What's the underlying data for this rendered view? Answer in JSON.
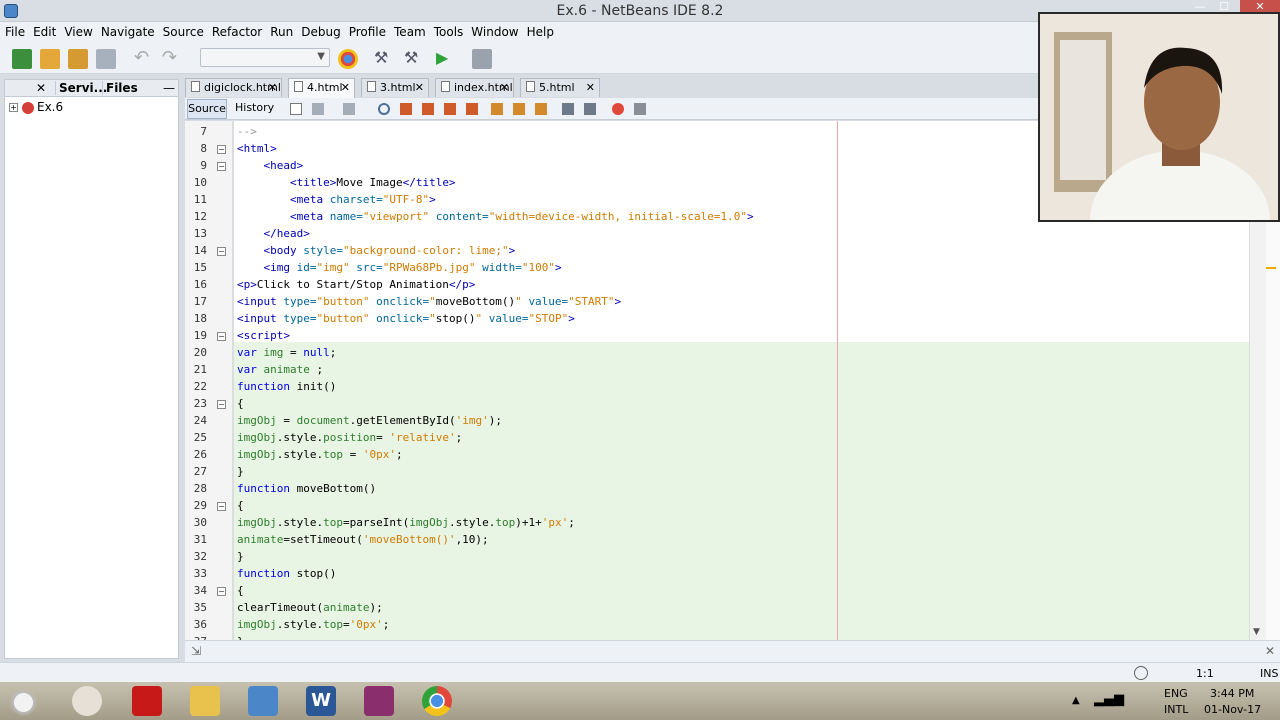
{
  "window": {
    "title": "Ex.6 - NetBeans IDE 8.2",
    "minimize": "—",
    "maximize": "☐",
    "close": "✕"
  },
  "menu": [
    "File",
    "Edit",
    "View",
    "Navigate",
    "Source",
    "Refactor",
    "Run",
    "Debug",
    "Profile",
    "Team",
    "Tools",
    "Window",
    "Help"
  ],
  "left_panel": {
    "tabs": [
      "Servi...",
      "Files"
    ],
    "close_symbol": "✕",
    "minimize_symbol": "—",
    "project": {
      "expander": "+",
      "name": "Ex.6"
    }
  },
  "editor_tabs": [
    {
      "label": "digiclock.html",
      "active": false
    },
    {
      "label": "4.html",
      "active": true
    },
    {
      "label": "3.html",
      "active": false
    },
    {
      "label": "index.html",
      "active": false
    },
    {
      "label": "5.html",
      "active": false
    }
  ],
  "editor_toolbar": {
    "source": "Source",
    "history": "History"
  },
  "code": {
    "lines": [
      {
        "n": "7",
        "fold": "",
        "segs": [
          [
            "cmt",
            "-->"
          ]
        ]
      },
      {
        "n": "8",
        "fold": "−",
        "segs": [
          [
            "tag",
            "<html>"
          ]
        ]
      },
      {
        "n": "9",
        "fold": "−",
        "segs": [
          [
            "",
            "    "
          ],
          [
            "tag",
            "<head>"
          ]
        ]
      },
      {
        "n": "10",
        "fold": "",
        "segs": [
          [
            "",
            "        "
          ],
          [
            "tag",
            "<title>"
          ],
          [
            "",
            "Move Image"
          ],
          [
            "tag",
            "</title>"
          ]
        ]
      },
      {
        "n": "11",
        "fold": "",
        "segs": [
          [
            "",
            "        "
          ],
          [
            "tag",
            "<meta "
          ],
          [
            "attr",
            "charset="
          ],
          [
            "str",
            "\"UTF-8\""
          ],
          [
            "tag",
            ">"
          ]
        ]
      },
      {
        "n": "12",
        "fold": "",
        "segs": [
          [
            "",
            "        "
          ],
          [
            "tag",
            "<meta "
          ],
          [
            "attr",
            "name="
          ],
          [
            "str",
            "\"viewport\" "
          ],
          [
            "attr",
            "content="
          ],
          [
            "str",
            "\"width=device-width, initial-scale=1.0\""
          ],
          [
            "tag",
            ">"
          ]
        ]
      },
      {
        "n": "13",
        "fold": "",
        "segs": [
          [
            "",
            "    "
          ],
          [
            "tag",
            "</head>"
          ]
        ]
      },
      {
        "n": "14",
        "fold": "−",
        "segs": [
          [
            "",
            "    "
          ],
          [
            "tag",
            "<body "
          ],
          [
            "attr",
            "style="
          ],
          [
            "str",
            "\"background-color: lime;\""
          ],
          [
            "tag",
            ">"
          ]
        ]
      },
      {
        "n": "15",
        "fold": "",
        "segs": [
          [
            "",
            "    "
          ],
          [
            "tag",
            "<img "
          ],
          [
            "attr",
            "id="
          ],
          [
            "str",
            "\"img\" "
          ],
          [
            "attr",
            "src="
          ],
          [
            "str",
            "\"RPWa68Pb.jpg\" "
          ],
          [
            "attr",
            "width="
          ],
          [
            "str",
            "\"100\""
          ],
          [
            "tag",
            ">"
          ]
        ]
      },
      {
        "n": "16",
        "fold": "",
        "segs": [
          [
            "tag",
            "<p>"
          ],
          [
            "",
            "Click to Start/Stop Animation"
          ],
          [
            "tag",
            "</p>"
          ]
        ]
      },
      {
        "n": "17",
        "fold": "",
        "segs": [
          [
            "tag",
            "<input "
          ],
          [
            "attr",
            "type="
          ],
          [
            "str",
            "\"button\" "
          ],
          [
            "attr",
            "onclick="
          ],
          [
            "str",
            "\""
          ],
          [
            "",
            "moveBottom()"
          ],
          [
            "str",
            "\" "
          ],
          [
            "attr",
            "value="
          ],
          [
            "str",
            "\"START\""
          ],
          [
            "tag",
            ">"
          ]
        ]
      },
      {
        "n": "18",
        "fold": "",
        "segs": [
          [
            "tag",
            "<input "
          ],
          [
            "attr",
            "type="
          ],
          [
            "str",
            "\"button\" "
          ],
          [
            "attr",
            "onclick="
          ],
          [
            "str",
            "\""
          ],
          [
            "",
            "stop()"
          ],
          [
            "str",
            "\" "
          ],
          [
            "attr",
            "value="
          ],
          [
            "str",
            "\"STOP\""
          ],
          [
            "tag",
            ">"
          ]
        ]
      },
      {
        "n": "19",
        "fold": "−",
        "segs": [
          [
            "tag",
            "<script>"
          ]
        ]
      },
      {
        "n": "20",
        "fold": "",
        "segs": [
          [
            "kw",
            "var "
          ],
          [
            "var",
            "img"
          ],
          [
            "",
            " = "
          ],
          [
            "kw",
            "null"
          ],
          [
            "",
            ";"
          ]
        ]
      },
      {
        "n": "21",
        "fold": "",
        "segs": [
          [
            "kw",
            "var "
          ],
          [
            "var",
            "animate"
          ],
          [
            "",
            " ;"
          ]
        ]
      },
      {
        "n": "22",
        "fold": "",
        "segs": [
          [
            "kw",
            "function "
          ],
          [
            "",
            "init()"
          ]
        ]
      },
      {
        "n": "23",
        "fold": "−",
        "segs": [
          [
            "",
            "{"
          ]
        ]
      },
      {
        "n": "24",
        "fold": "",
        "segs": [
          [
            "var",
            "imgObj"
          ],
          [
            "",
            " = "
          ],
          [
            "var",
            "document"
          ],
          [
            "",
            ".getElementById("
          ],
          [
            "str",
            "'img'"
          ],
          [
            "",
            ");"
          ]
        ]
      },
      {
        "n": "25",
        "fold": "",
        "segs": [
          [
            "var",
            "imgObj"
          ],
          [
            "",
            ".style."
          ],
          [
            "var",
            "position"
          ],
          [
            "",
            "= "
          ],
          [
            "str",
            "'relative'"
          ],
          [
            "",
            ";"
          ]
        ]
      },
      {
        "n": "26",
        "fold": "",
        "segs": [
          [
            "var",
            "imgObj"
          ],
          [
            "",
            ".style."
          ],
          [
            "var",
            "top"
          ],
          [
            "",
            " = "
          ],
          [
            "str",
            "'0px'"
          ],
          [
            "",
            ";"
          ]
        ]
      },
      {
        "n": "27",
        "fold": "",
        "segs": [
          [
            "",
            "}"
          ]
        ]
      },
      {
        "n": "28",
        "fold": "",
        "segs": [
          [
            "kw",
            "function "
          ],
          [
            "",
            "moveBottom()"
          ]
        ]
      },
      {
        "n": "29",
        "fold": "−",
        "segs": [
          [
            "",
            "{"
          ]
        ]
      },
      {
        "n": "30",
        "fold": "",
        "segs": [
          [
            "var",
            "imgObj"
          ],
          [
            "",
            ".style."
          ],
          [
            "var",
            "top"
          ],
          [
            "",
            "=parseInt("
          ],
          [
            "var",
            "imgObj"
          ],
          [
            "",
            ".style."
          ],
          [
            "var",
            "top"
          ],
          [
            "",
            ")+1+"
          ],
          [
            "str",
            "'px'"
          ],
          [
            "",
            ";"
          ]
        ]
      },
      {
        "n": "31",
        "fold": "",
        "segs": [
          [
            "var",
            "animate"
          ],
          [
            "",
            "=setTimeout("
          ],
          [
            "str",
            "'moveBottom()'"
          ],
          [
            "",
            ",10);"
          ]
        ]
      },
      {
        "n": "32",
        "fold": "",
        "segs": [
          [
            "",
            "}"
          ]
        ]
      },
      {
        "n": "33",
        "fold": "",
        "segs": [
          [
            "kw",
            "function "
          ],
          [
            "",
            "stop()"
          ]
        ]
      },
      {
        "n": "34",
        "fold": "−",
        "segs": [
          [
            "",
            "{"
          ]
        ]
      },
      {
        "n": "35",
        "fold": "",
        "segs": [
          [
            "",
            "clearTimeout("
          ],
          [
            "var",
            "animate"
          ],
          [
            "",
            ");"
          ]
        ]
      },
      {
        "n": "36",
        "fold": "",
        "segs": [
          [
            "var",
            "imgObj"
          ],
          [
            "",
            ".style."
          ],
          [
            "var",
            "top"
          ],
          [
            "",
            "="
          ],
          [
            "str",
            "'0px'"
          ],
          [
            "",
            ";"
          ]
        ]
      },
      {
        "n": "37",
        "fold": "",
        "segs": [
          [
            "",
            "}"
          ]
        ]
      }
    ]
  },
  "status": {
    "position": "1:1",
    "mode": "INS"
  },
  "taskbar": {
    "lang": "ENG",
    "layout": "INTL",
    "time": "3:44 PM",
    "date": "01-Nov-17",
    "apps": [
      "apple-icon",
      "puzzle-icon",
      "game-icon",
      "folder-icon",
      "netbeans-icon",
      "word-icon",
      "media-icon",
      "chrome-icon"
    ]
  },
  "colors": {
    "accent": "#4a86c8",
    "code_bg": "#ffffff",
    "highlight": "#e9f5e4",
    "taskbar": "#b3ad9a"
  }
}
